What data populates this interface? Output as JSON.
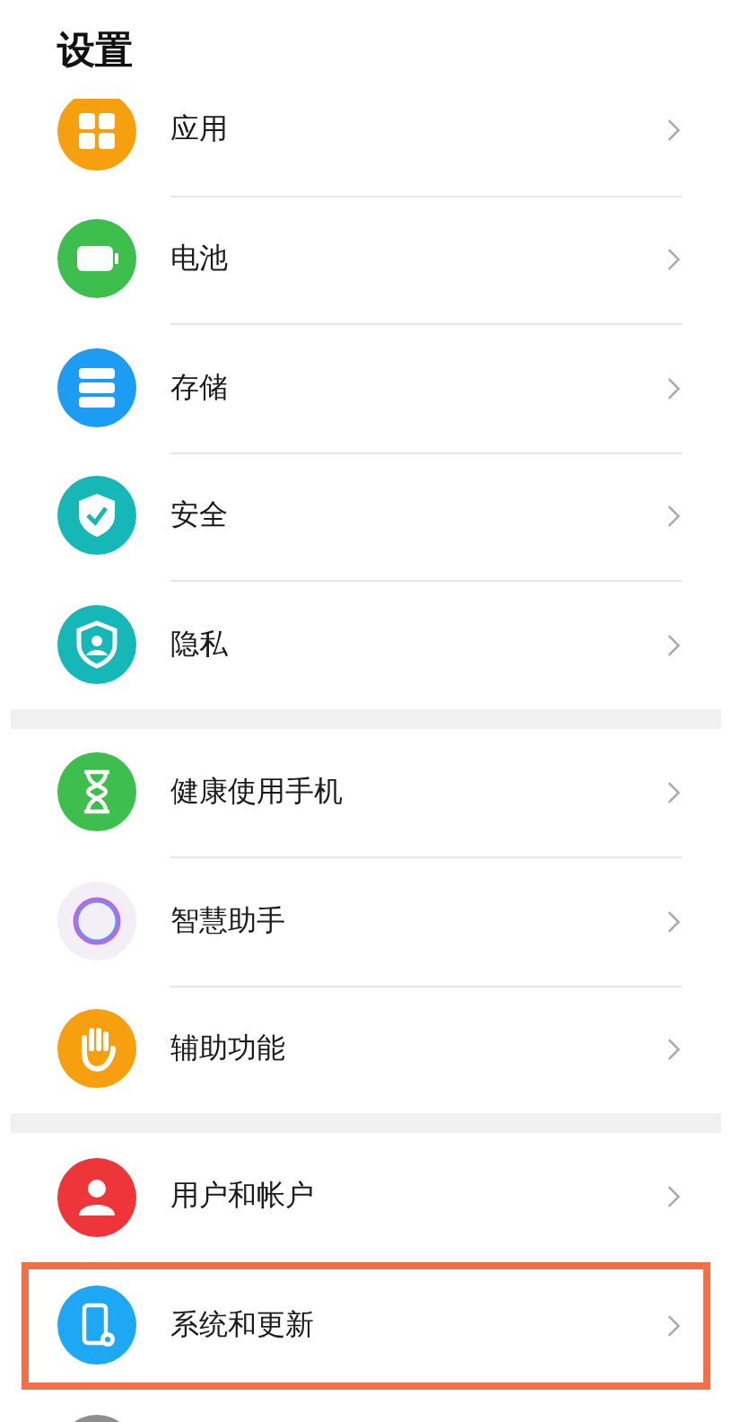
{
  "header": {
    "title": "设置"
  },
  "groups": [
    {
      "items": [
        {
          "kind": "apps",
          "label": "应用",
          "highlighted": false
        },
        {
          "kind": "battery",
          "label": "电池",
          "highlighted": false
        },
        {
          "kind": "storage",
          "label": "存储",
          "highlighted": false
        },
        {
          "kind": "security",
          "label": "安全",
          "highlighted": false
        },
        {
          "kind": "privacy",
          "label": "隐私",
          "highlighted": false
        }
      ]
    },
    {
      "items": [
        {
          "kind": "hourglass",
          "label": "健康使用手机",
          "highlighted": false
        },
        {
          "kind": "assistant",
          "label": "智慧助手",
          "highlighted": false
        },
        {
          "kind": "accessibility",
          "label": "辅助功能",
          "highlighted": false
        }
      ]
    },
    {
      "items": [
        {
          "kind": "user",
          "label": "用户和帐户",
          "highlighted": false
        },
        {
          "kind": "system",
          "label": "系统和更新",
          "highlighted": true
        },
        {
          "kind": "more",
          "highlighted": false
        }
      ]
    }
  ]
}
